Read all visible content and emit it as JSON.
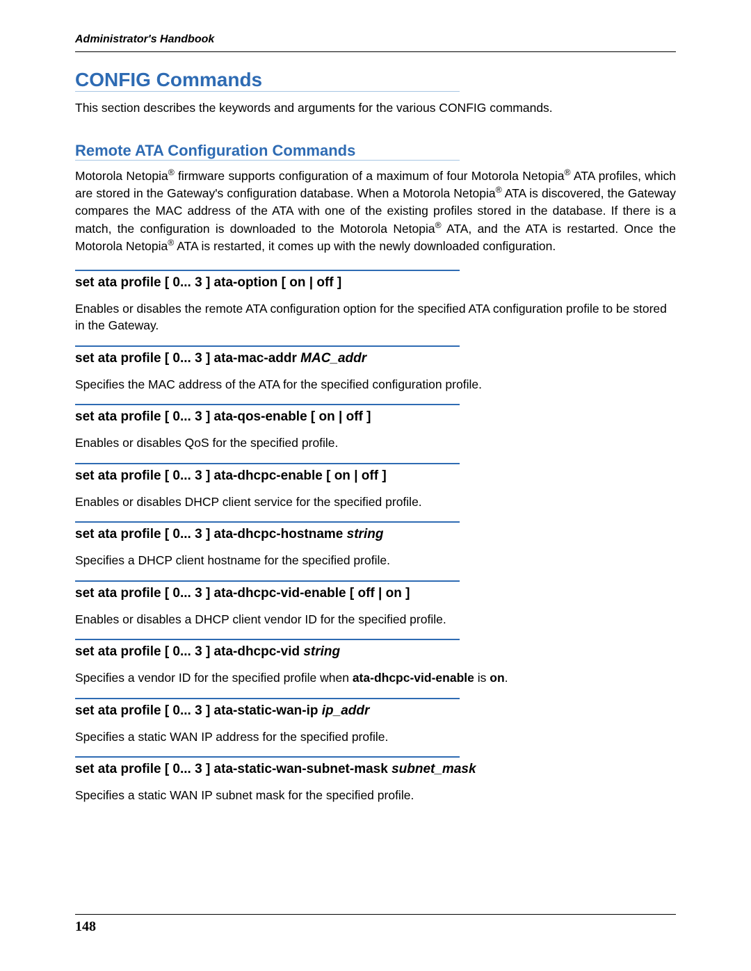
{
  "header": {
    "running_title": "Administrator's Handbook"
  },
  "main": {
    "title": "CONFIG Commands",
    "intro": "This section describes the keywords and arguments for the various CONFIG commands.",
    "subsection_title": "Remote ATA Configuration Commands",
    "subsection_para_html": "Motorola Netopia<sup>®</sup> firmware supports configuration of a maximum of four Motorola Netopia<sup>®</sup> ATA profiles, which are stored in the Gateway's configuration database. When a Motorola Netopia<sup>®</sup> ATA is discovered, the Gateway compares the MAC address of the ATA with one of the existing profiles stored in the database. If there is a match, the configuration is downloaded to the Motorola Netopia<sup>®</sup> ATA, and the ATA is restarted. Once the Motorola Netopia<sup>®</sup> ATA is restarted, it comes up with the newly downloaded configuration.",
    "commands": [
      {
        "title_html": "set ata profile [  0... 3 ] ata-option [ on | off ]",
        "desc_html": "Enables or disables the remote ATA configuration option for the specified ATA configuration profile to be stored in the Gateway."
      },
      {
        "title_html": "set ata profile [  0... 3 ] ata-mac-addr <span class=\"italic\">MAC_addr</span>",
        "desc_html": "Specifies the MAC address of the ATA for the specified configuration profile."
      },
      {
        "title_html": "set ata profile [  0... 3 ] ata-qos-enable [ on | off ]",
        "desc_html": "Enables or disables QoS for the specified profile."
      },
      {
        "title_html": "set ata profile [  0... 3 ] ata-dhcpc-enable [ on | off ]",
        "desc_html": "Enables or disables DHCP client service for the specified profile."
      },
      {
        "title_html": "set ata profile [  0... 3 ] ata-dhcpc-hostname <span class=\"italic\">string</span>",
        "desc_html": "Specifies a DHCP client hostname for the specified profile."
      },
      {
        "title_html": "set ata profile [  0... 3 ] ata-dhcpc-vid-enable [ off | on ]",
        "desc_html": "Enables or disables a DHCP client vendor ID for the specified profile."
      },
      {
        "title_html": "set ata profile [  0... 3 ] ata-dhcpc-vid <span class=\"italic\">string</span>",
        "desc_html": "Specifies a vendor ID for the specified profile when <span class=\"bold\">ata-dhcpc-vid-enable</span> is <span class=\"bold\">on</span>."
      },
      {
        "title_html": "set ata profile [  0... 3 ] ata-static-wan-ip <span class=\"italic\">ip_addr</span>",
        "desc_html": "Specifies a static WAN IP address for the specified profile."
      },
      {
        "title_html": "set ata profile [  0... 3 ] ata-static-wan-subnet-mask <span class=\"italic\">subnet_mask</span>",
        "desc_html": "Specifies a static WAN IP subnet mask for the specified profile."
      }
    ]
  },
  "footer": {
    "page_number": "148"
  }
}
